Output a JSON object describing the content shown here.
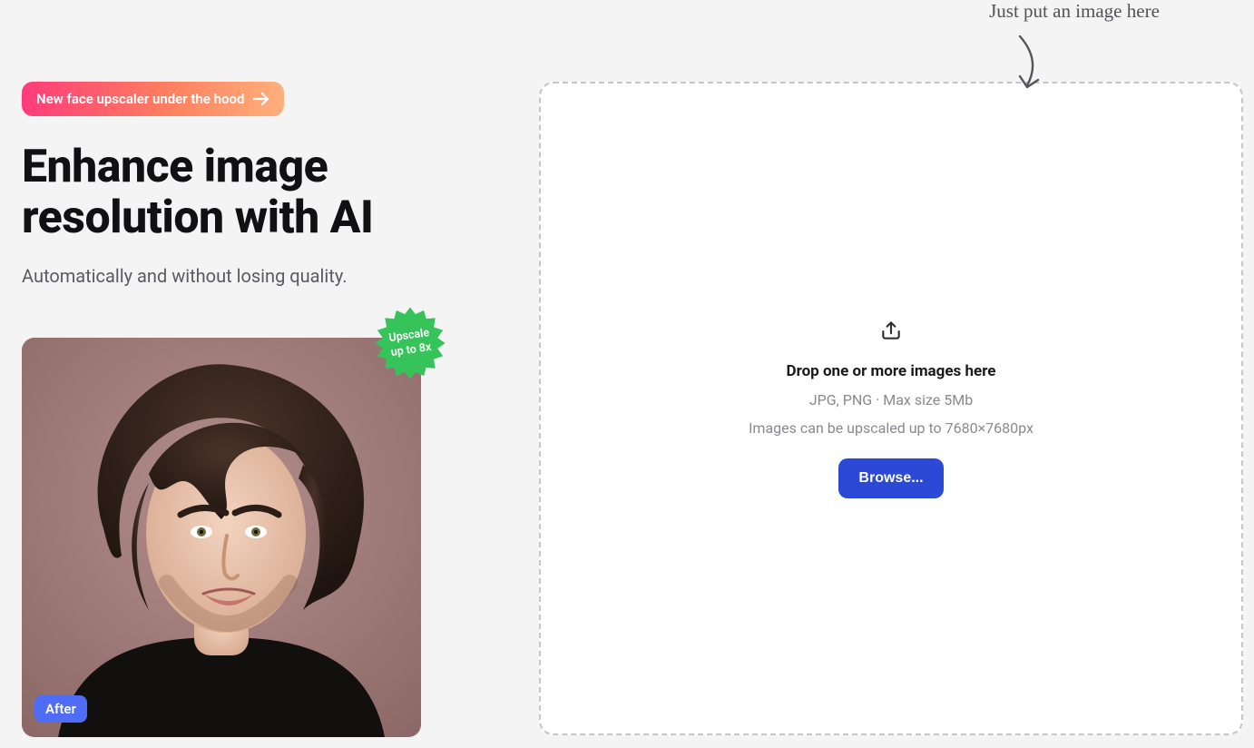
{
  "promo": {
    "label": "New face upscaler under the hood"
  },
  "hero": {
    "title_l1": "Enhance image",
    "title_l2": "resolution with AI",
    "subtitle": "Automatically and without losing quality."
  },
  "badge": {
    "line1": "Upscale",
    "line2": "up to 8x"
  },
  "preview": {
    "after_label": "After"
  },
  "note": {
    "text": "Just put an image here"
  },
  "dropzone": {
    "title": "Drop one or more images here",
    "line1": "JPG, PNG · Max size 5Mb",
    "line2": "Images can be upscaled up to 7680×7680px",
    "browse": "Browse..."
  }
}
